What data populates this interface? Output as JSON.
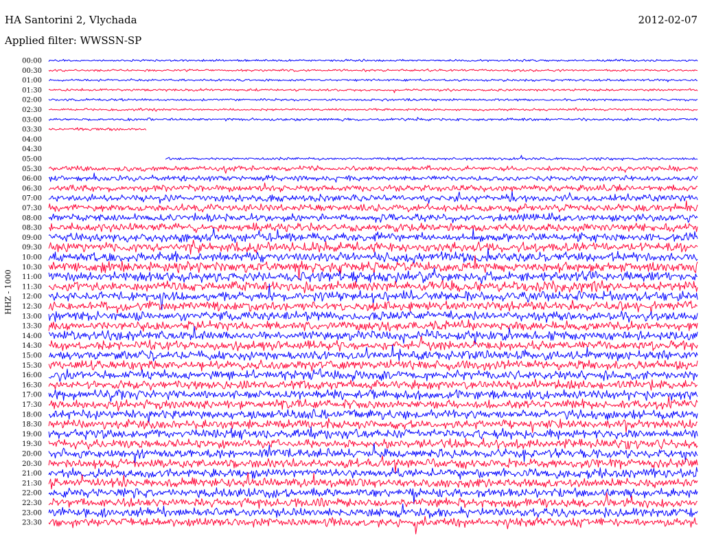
{
  "header": {
    "station": "HA Santorini 2, Vlychada",
    "filter": "Applied filter: WWSSN-SP",
    "date": "2012-02-07"
  },
  "chart_data": {
    "type": "line",
    "title": "HA Santorini 2, Vlychada",
    "subtitle": "Applied filter: WWSSN-SP",
    "ylabel": "HHZ - 1000",
    "xlabel": "",
    "grid": false,
    "legend": "none",
    "rows": [
      "00:00",
      "00:30",
      "01:00",
      "01:30",
      "02:00",
      "02:30",
      "03:00",
      "03:30",
      "04:00",
      "04:30",
      "05:00",
      "05:30",
      "06:00",
      "06:30",
      "07:00",
      "07:30",
      "08:00",
      "08:30",
      "09:00",
      "09:30",
      "10:00",
      "10:30",
      "11:00",
      "11:30",
      "12:00",
      "12:30",
      "13:00",
      "13:30",
      "14:00",
      "14:30",
      "15:00",
      "15:30",
      "16:00",
      "16:30",
      "17:00",
      "17:30",
      "18:00",
      "18:30",
      "19:00",
      "19:30",
      "20:00",
      "20:30",
      "21:00",
      "21:30",
      "22:00",
      "22:30",
      "23:00",
      "23:30"
    ],
    "trace_colors": [
      "#0000ff",
      "#ff0033"
    ],
    "series": [
      {
        "values": [
          0.25,
          0.25,
          0.25,
          0.25,
          0.25,
          0.25,
          0.3,
          0.3,
          0.45,
          0.3,
          0.3,
          0.55,
          0.6,
          0.7,
          0.75,
          0.8,
          0.85,
          0.9,
          0.95,
          1.0,
          1.05,
          1.1,
          1.1,
          1.1,
          1.05,
          1.05,
          1.0,
          1.0,
          1.0,
          1.0,
          1.0,
          1.0,
          1.0,
          1.0,
          1.0,
          1.0,
          1.0,
          1.0,
          1.0,
          1.0,
          1.0,
          1.0,
          1.0,
          1.0,
          1.0,
          1.0,
          1.0,
          1.0
        ]
      }
    ],
    "gap": {
      "start_row": "03:30",
      "start_fraction": 0.15,
      "end_row": "05:00",
      "end_fraction": 0.18
    }
  }
}
